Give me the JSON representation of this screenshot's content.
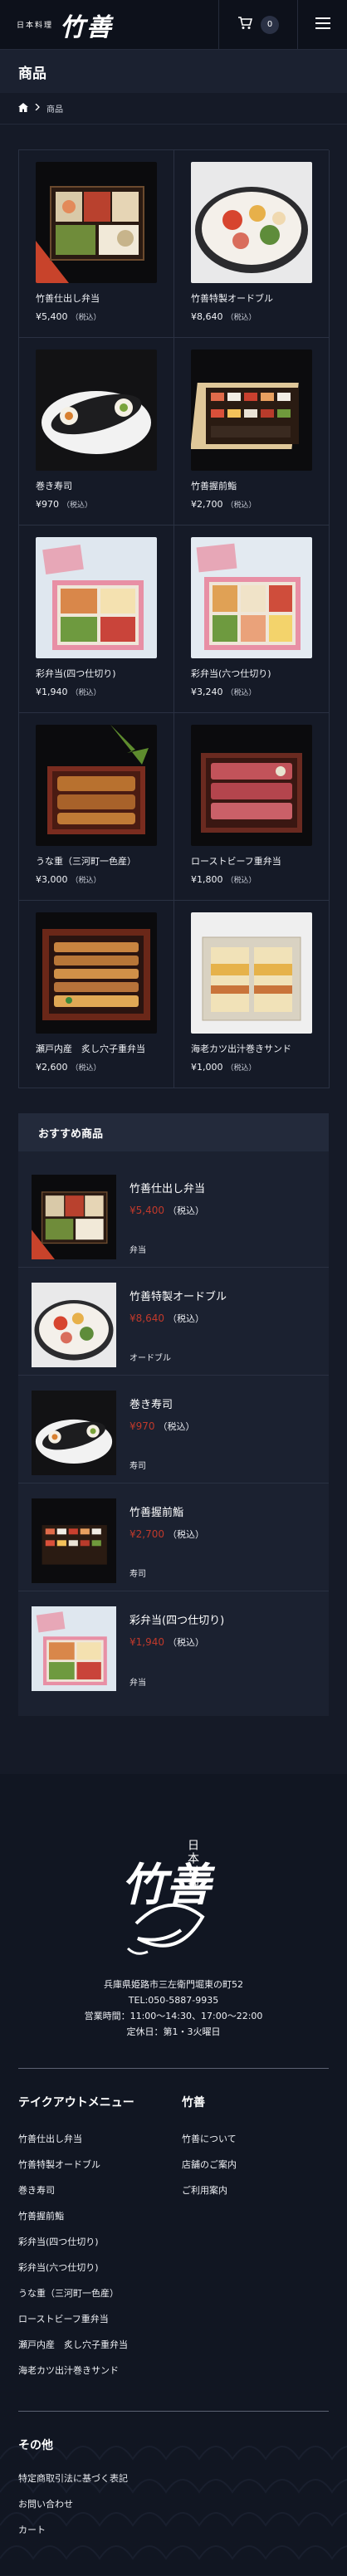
{
  "header": {
    "logo_small": "日本料理",
    "logo_big": "竹善",
    "cart_count": "0"
  },
  "page": {
    "title": "商品",
    "breadcrumb_current": "商品"
  },
  "products": [
    {
      "name": "竹善仕出し弁当",
      "price": "¥5,400",
      "tax": "（税込）"
    },
    {
      "name": "竹善特製オードブル",
      "price": "¥8,640",
      "tax": "（税込）"
    },
    {
      "name": "巻き寿司",
      "price": "¥970",
      "tax": "（税込）"
    },
    {
      "name": "竹善握前鮨",
      "price": "¥2,700",
      "tax": "（税込）"
    },
    {
      "name": "彩弁当(四つ仕切り)",
      "price": "¥1,940",
      "tax": "（税込）"
    },
    {
      "name": "彩弁当(六つ仕切り)",
      "price": "¥3,240",
      "tax": "（税込）"
    },
    {
      "name": "うな重（三河町一色産）",
      "price": "¥3,000",
      "tax": "（税込）"
    },
    {
      "name": "ローストビーフ重弁当",
      "price": "¥1,800",
      "tax": "（税込）"
    },
    {
      "name": "瀬戸内産　炙し穴子重弁当",
      "price": "¥2,600",
      "tax": "（税込）"
    },
    {
      "name": "海老カツ出汁巻きサンド",
      "price": "¥1,000",
      "tax": "（税込）"
    }
  ],
  "recommended": {
    "heading": "おすすめ商品",
    "items": [
      {
        "name": "竹善仕出し弁当",
        "price": "¥5,400",
        "tax": "（税込）",
        "category": "弁当"
      },
      {
        "name": "竹善特製オードブル",
        "price": "¥8,640",
        "tax": "（税込）",
        "category": "オードブル"
      },
      {
        "name": "巻き寿司",
        "price": "¥970",
        "tax": "（税込）",
        "category": "寿司"
      },
      {
        "name": "竹善握前鮨",
        "price": "¥2,700",
        "tax": "（税込）",
        "category": "寿司"
      },
      {
        "name": "彩弁当(四つ仕切り)",
        "price": "¥1,940",
        "tax": "（税込）",
        "category": "弁当"
      }
    ]
  },
  "footer": {
    "logo_text": "日本料理",
    "logo_big": "竹善",
    "address": "兵庫県姫路市三左衛門堀東の町52",
    "tel": "TEL:050-5887-9935",
    "hours": "営業時間：11:00〜14:30、17:00〜22:00",
    "holiday": "定休日：第1・3火曜日",
    "takeout_heading": "テイクアウトメニュー",
    "takeout_links": [
      "竹善仕出し弁当",
      "竹善特製オードブル",
      "巻き寿司",
      "竹善握前鮨",
      "彩弁当(四つ仕切り)",
      "彩弁当(六つ仕切り)",
      "うな重（三河町一色産）",
      "ローストビーフ重弁当",
      "瀬戸内産　炙し穴子重弁当",
      "海老カツ出汁巻きサンド"
    ],
    "shop_heading": "竹善",
    "shop_links": [
      "竹善について",
      "店舗のご案内",
      "ご利用案内"
    ],
    "other_heading": "その他",
    "other_links": [
      "特定商取引法に基づく表記",
      "お問い合わせ",
      "カート"
    ]
  },
  "colors": {
    "background": "#151a27",
    "price_red": "#c0392b"
  }
}
